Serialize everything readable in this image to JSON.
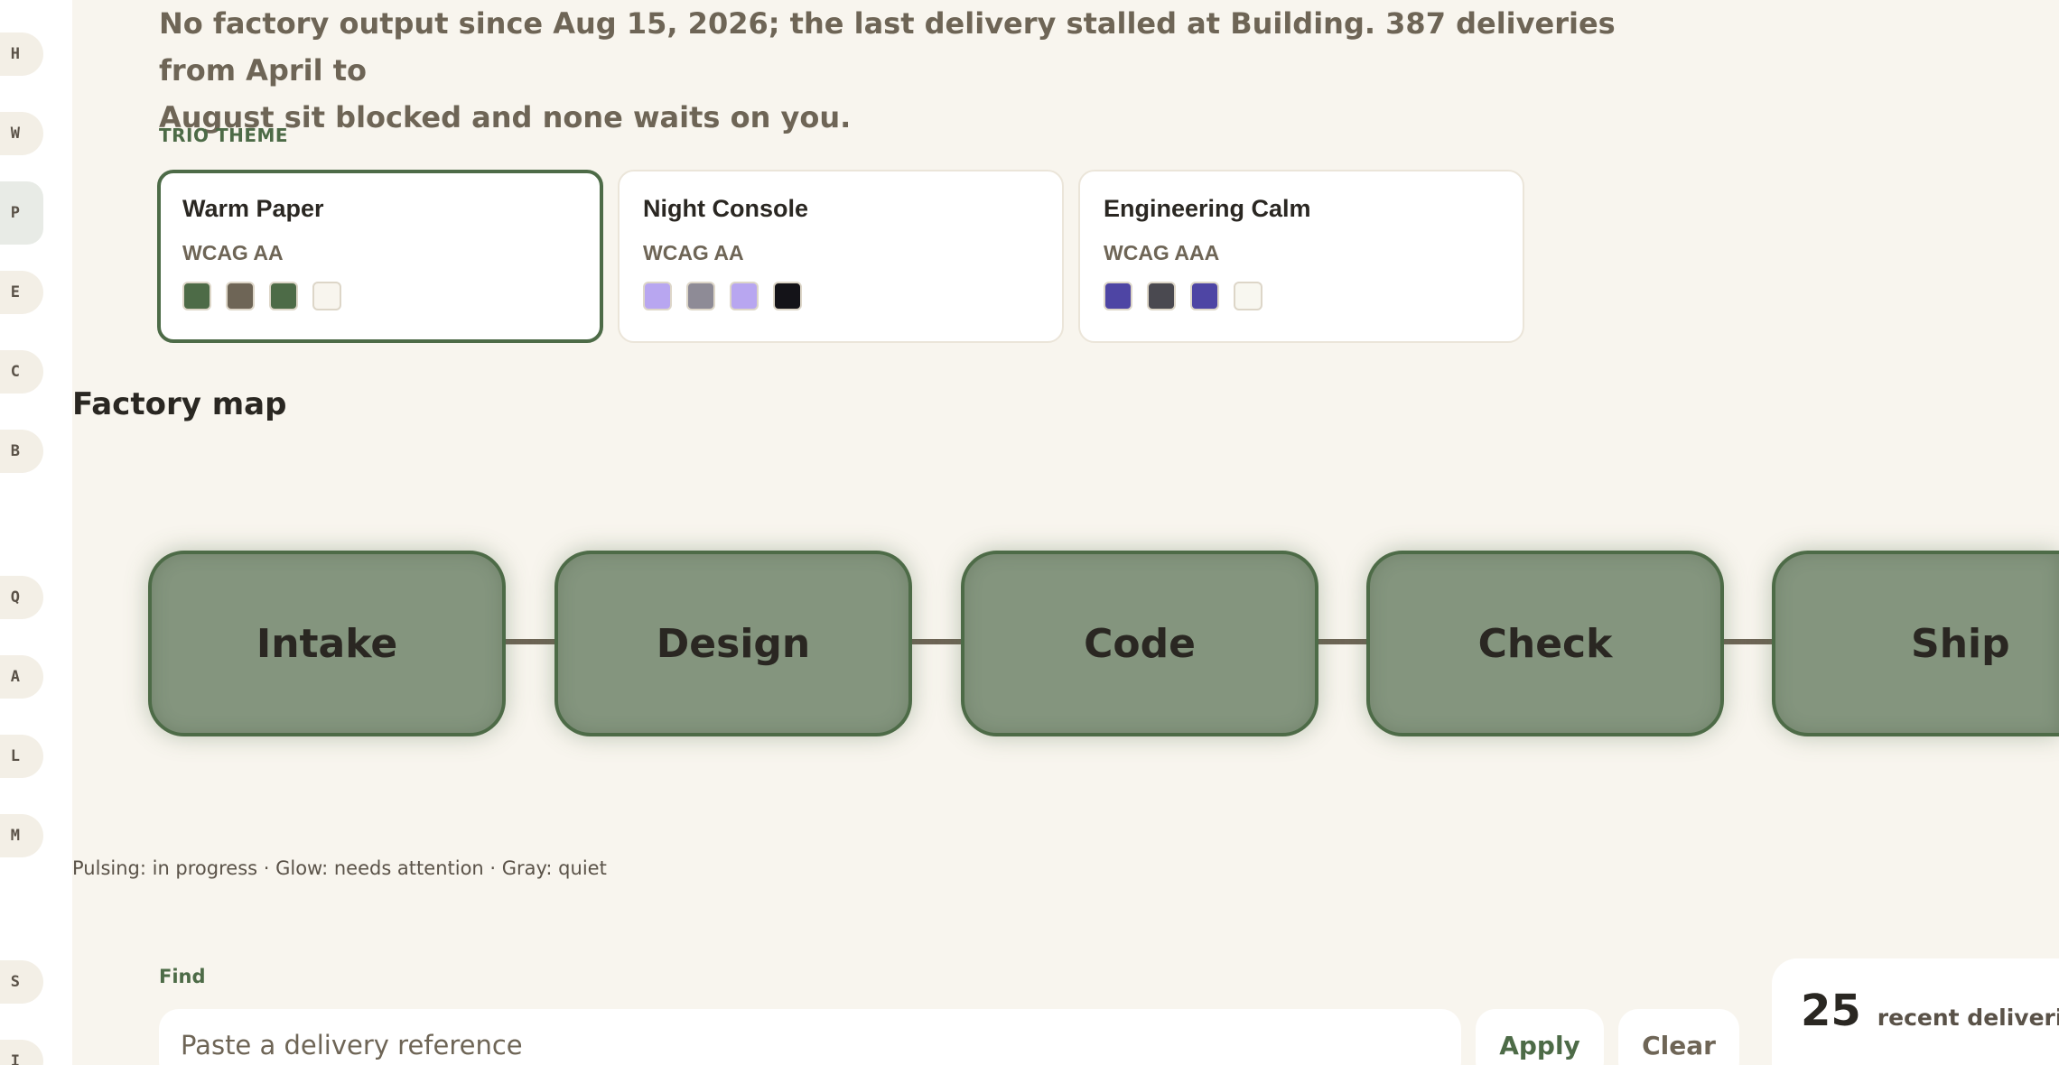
{
  "summary": {
    "line1": "No factory output since Aug 15, 2026; the last delivery stalled at Building. 387 deliveries from April to",
    "line2": "August sit blocked and none waits on you."
  },
  "rail": {
    "items": [
      {
        "label": "H"
      },
      {
        "label": "W"
      },
      {
        "label": "P",
        "active": true
      },
      {
        "label": "E"
      },
      {
        "label": "C"
      },
      {
        "label": "B"
      },
      {
        "label": "Q"
      },
      {
        "label": "A"
      },
      {
        "label": "L"
      },
      {
        "label": "M"
      },
      {
        "label": "S"
      },
      {
        "label": "I"
      }
    ]
  },
  "theme_section": {
    "label": "TRIO THEME",
    "cards": [
      {
        "name": "Warm Paper",
        "wcag": "WCAG AA",
        "selected": true,
        "swatches": [
          "#4d6b47",
          "#6e6556",
          "#4d6b47",
          "#f8f5ee"
        ]
      },
      {
        "name": "Night Console",
        "wcag": "WCAG AA",
        "selected": false,
        "swatches": [
          "#b8a6f0",
          "#8e8b96",
          "#b8a6f0",
          "#141318"
        ]
      },
      {
        "name": "Engineering Calm",
        "wcag": "WCAG AAA",
        "selected": false,
        "swatches": [
          "#4e45a4",
          "#4a4950",
          "#4e45a4",
          "#f8f7f0"
        ]
      }
    ]
  },
  "factory_map": {
    "title": "Factory map",
    "stages": [
      {
        "label": "Intake"
      },
      {
        "label": "Design"
      },
      {
        "label": "Code"
      },
      {
        "label": "Check"
      },
      {
        "label": "Ship"
      }
    ],
    "legend": "Pulsing: in progress · Glow: needs attention · Gray: quiet"
  },
  "find": {
    "label": "Find",
    "placeholder": "Paste a delivery reference",
    "value": "",
    "apply_label": "Apply",
    "clear_label": "Clear"
  },
  "stat": {
    "value": "25",
    "label": "recent deliveries"
  },
  "colors": {
    "accent": "#4d6b47",
    "background": "#f8f5ee",
    "stage_fill": "#84957e"
  }
}
